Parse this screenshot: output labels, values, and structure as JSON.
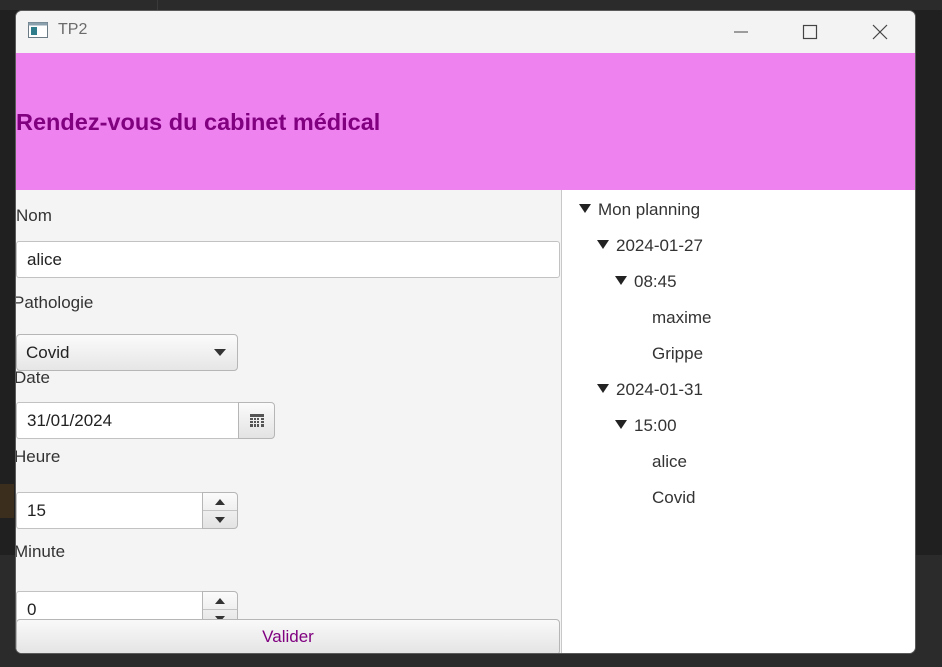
{
  "window": {
    "title": "TP2"
  },
  "header": {
    "title": "Rendez-vous du cabinet médical",
    "background": "#ee82ee",
    "text_color": "#800080"
  },
  "form": {
    "nom_label": "Nom",
    "nom_value": "alice",
    "pathologie_label": "Pathologie",
    "pathologie_value": "Covid",
    "date_label": "Date",
    "date_value": "31/01/2024",
    "heure_label": "Heure",
    "heure_value": "15",
    "minute_label": "Minute",
    "minute_value": "0",
    "submit_label": "Valider",
    "submit_color": "#800080"
  },
  "tree": {
    "root": "Mon planning",
    "days": [
      {
        "date": "2024-01-27",
        "slots": [
          {
            "time": "08:45",
            "patient": "maxime",
            "pathology": "Grippe"
          }
        ]
      },
      {
        "date": "2024-01-31",
        "slots": [
          {
            "time": "15:00",
            "patient": "alice",
            "pathology": "Covid"
          }
        ]
      }
    ]
  },
  "icons": {
    "app": "app-window-icon",
    "minimize": "minimize-icon",
    "maximize": "maximize-icon",
    "close": "close-icon",
    "calendar": "calendar-icon"
  }
}
